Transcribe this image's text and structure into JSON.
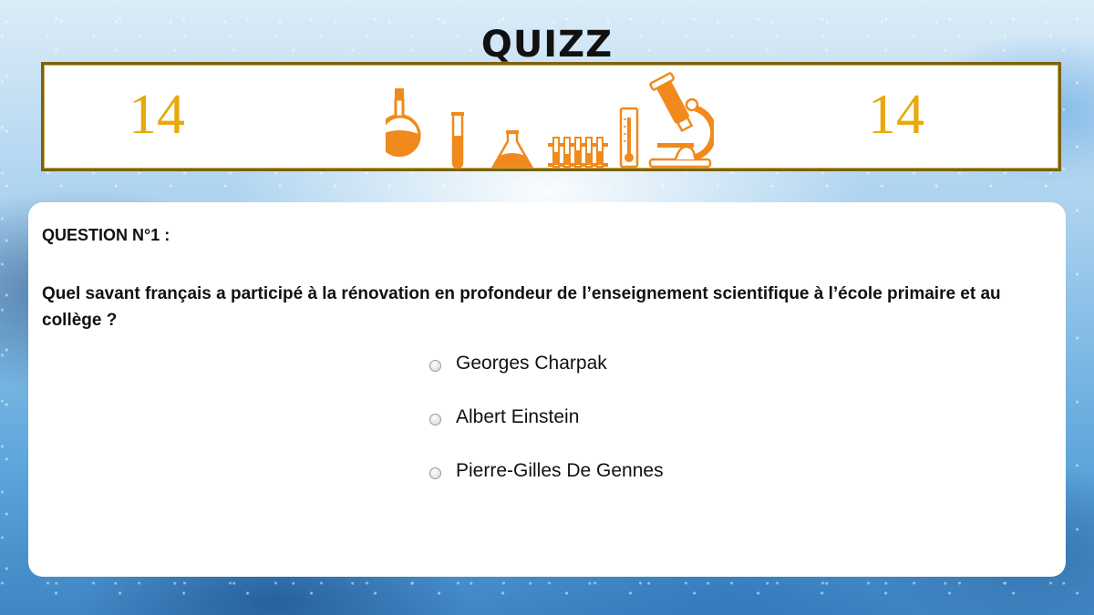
{
  "header": {
    "title": "QUIZZ"
  },
  "banner": {
    "left_counter": "14",
    "right_counter": "14",
    "icons": [
      "round-flask-icon",
      "test-tube-icon",
      "erlenmeyer-flask-icon",
      "test-tube-rack-icon",
      "thermometer-icon",
      "microscope-icon"
    ]
  },
  "colors": {
    "accent_orange": "#f08a1c",
    "counter_gold": "#e8a90c",
    "banner_border": "#7a6212"
  },
  "question": {
    "number_label": "QUESTION N°1 :",
    "text": "Quel savant français a participé à la rénovation en profondeur de l’enseignement scientifique à l’école primaire et au collège ?",
    "options": [
      {
        "label": "Georges Charpak"
      },
      {
        "label": "Albert Einstein"
      },
      {
        "label": "Pierre-Gilles De Gennes"
      }
    ]
  }
}
